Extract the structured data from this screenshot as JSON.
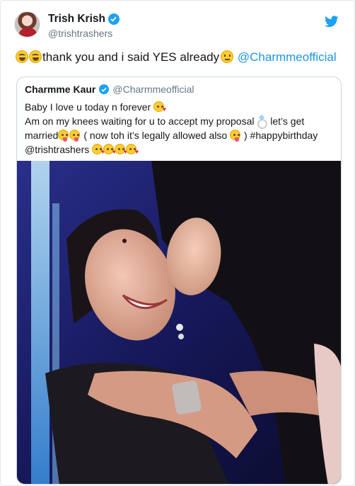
{
  "tweet": {
    "author": {
      "name": "Trish Krish",
      "handle": "@trishtrashers",
      "verified": true,
      "avatar_icon": "profile-photo"
    },
    "text": {
      "emojis_lead": [
        "joy-emoji",
        "joy-emoji"
      ],
      "body": "thank you and i said YES already",
      "emoji_trail": "neutral-face-emoji",
      "mention": "@Charmmeofficial"
    },
    "brand_icon": "twitter-bird-icon",
    "brand_color": "#1da1f2",
    "link_color": "#1b95e0"
  },
  "quoted_tweet": {
    "author": {
      "name": "Charmme Kaur",
      "handle": "@Charmmeofficial",
      "verified": true
    },
    "lines": [
      "Baby I love u today n forever",
      "Am on my knees waiting for u to accept my proposal",
      "let’s get",
      "married",
      "( now toh it’s legally allowed also",
      ") #happybirthday",
      "@trishtrashers"
    ],
    "emojis": [
      "kiss-emoji",
      "ring-emoji",
      "tongue-emoji",
      "tongue-emoji",
      "tongue-emoji",
      "kiss-emoji",
      "kiss-emoji",
      "kiss-emoji",
      "kiss-emoji"
    ],
    "photo": "two-women-hugging-photo"
  }
}
